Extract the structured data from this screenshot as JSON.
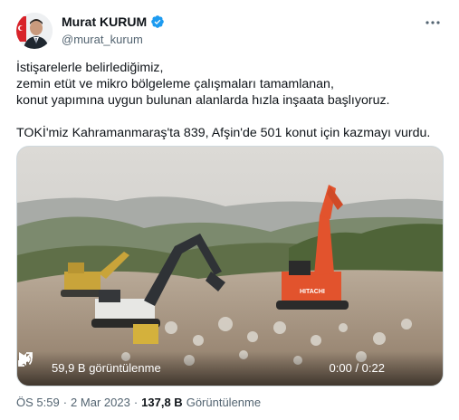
{
  "author": {
    "display_name": "Murat KURUM",
    "handle": "@murat_kurum",
    "verified_icon": "verified-badge-icon",
    "avatar_icon": "avatar-photo"
  },
  "more_icon": "more-options-icon",
  "tweet_lines": [
    "İstişarelerle belirlediğimiz,",
    "zemin etüt ve mikro bölgeleme çalışmaları tamamlanan,",
    "konut yapımına uygun bulunan alanlarda hızla inşaata başlıyoruz.",
    "TOKİ'miz Kahramanmaraş'ta 839, Afşin'de 501 konut için kazmayı vurdu."
  ],
  "video": {
    "views": "59,9 B görüntülenme",
    "time": "0:00 / 0:22",
    "play_icon": "play-icon",
    "volume_icon": "volume-icon",
    "fullscreen_icon": "fullscreen-icon",
    "excavator_label": "HITACHI"
  },
  "footer": {
    "time": "ÖS 5:59",
    "sep1": "·",
    "date": "2 Mar 2023",
    "sep2": "·",
    "views_count": "137,8 B",
    "views_label": "Görüntülenme"
  },
  "colors": {
    "verified": "#1d9bf0",
    "text": "#0f1419",
    "secondary": "#536471",
    "border": "#cfd9de"
  }
}
